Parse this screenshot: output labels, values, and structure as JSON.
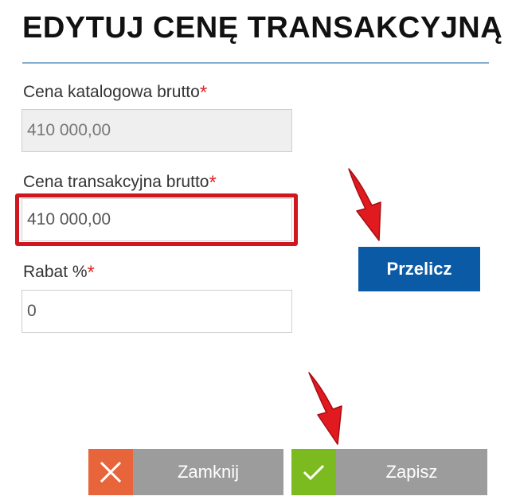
{
  "dialog": {
    "title": "EDYTUJ CENĘ TRANSAKCYJNĄ"
  },
  "fields": {
    "list_price": {
      "label": "Cena katalogowa brutto",
      "required_mark": "*",
      "value": "410 000,00"
    },
    "transaction_price": {
      "label": "Cena transakcyjna brutto",
      "required_mark": "*",
      "value": "410 000,00"
    },
    "discount": {
      "label": "Rabat %",
      "required_mark": "*",
      "value": "0"
    }
  },
  "buttons": {
    "recalculate": "Przelicz",
    "close": "Zamknij",
    "save": "Zapisz"
  },
  "colors": {
    "accent_blue": "#0b5aa6",
    "highlight_red": "#d0161e",
    "close_icon_bg": "#e8643b",
    "save_icon_bg": "#7cbb1f",
    "button_gray": "#9c9c9c"
  },
  "icons": {
    "close": "close-icon",
    "save": "check-icon",
    "annotation": "red-arrow-icon"
  }
}
